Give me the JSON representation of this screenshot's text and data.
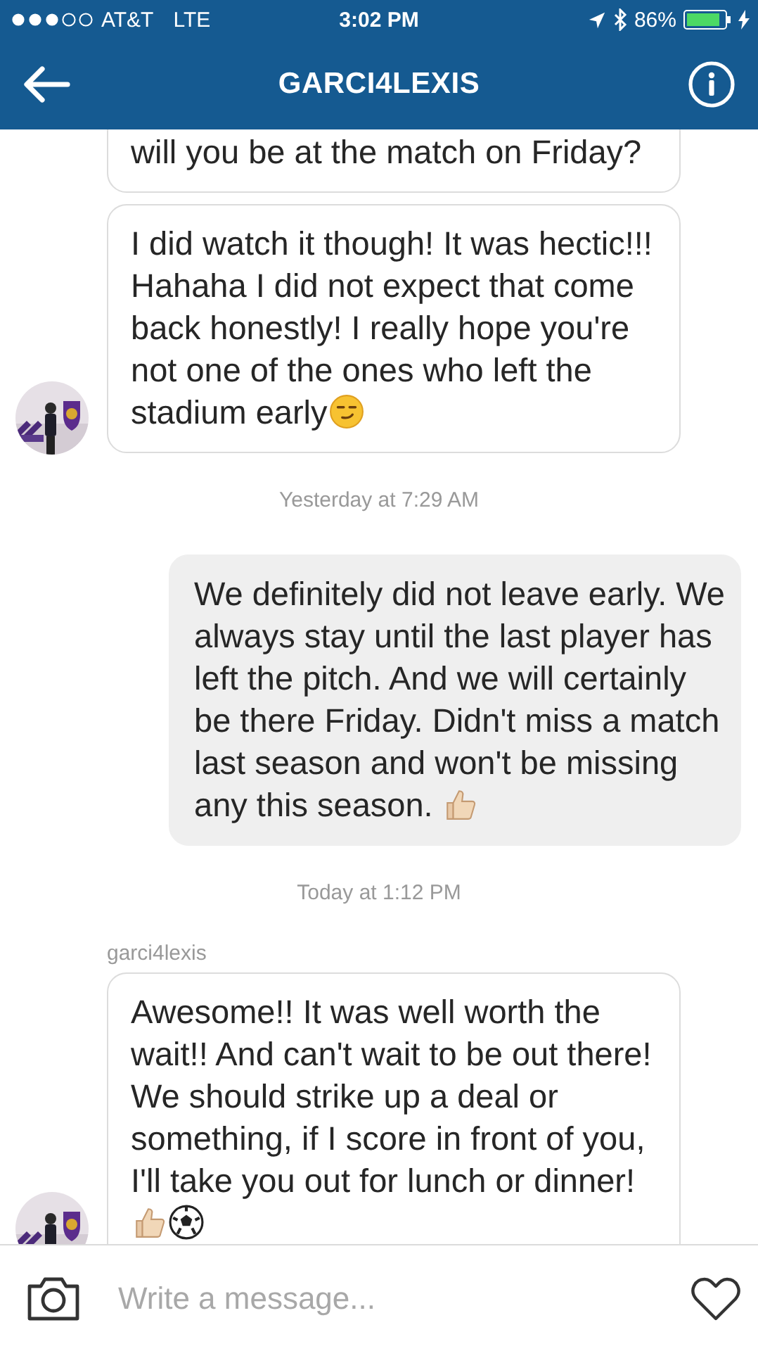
{
  "status_bar": {
    "carrier": "AT&T",
    "network": "LTE",
    "time": "3:02 PM",
    "battery": "86%"
  },
  "header": {
    "title": "GARCI4LEXIS"
  },
  "messages": [
    {
      "kind": "received",
      "text": "will you be at the match on Friday?"
    },
    {
      "kind": "received",
      "text": "I did watch it though! It was hectic!!! Hahaha I did not expect that come back honestly! I really hope you're not one of the ones who left the stadium early",
      "emoji": [
        {
          "kind": "smirk"
        }
      ],
      "avatar": true
    },
    {
      "kind": "timestamp",
      "text": "Yesterday at 7:29 AM"
    },
    {
      "kind": "sent",
      "text": "We definitely did not leave early. We always stay until the last player has left the pitch. And we will certainly be there Friday. Didn't miss a match last season and won't be missing any this season. ",
      "emoji": [
        {
          "kind": "thumbs-up"
        }
      ]
    },
    {
      "kind": "timestamp",
      "text": "Today at 1:12 PM"
    },
    {
      "kind": "sender",
      "text": "garci4lexis"
    },
    {
      "kind": "received",
      "text": "Awesome!! It was well worth the wait!! And can't wait to be out there! We should strike up a deal or something, if I score in front of you, I'll take you out for lunch or dinner!",
      "emoji": [
        {
          "kind": "thumbs-up"
        },
        {
          "kind": "soccer-ball"
        }
      ],
      "avatar": true
    }
  ],
  "composer": {
    "placeholder": "Write a message..."
  }
}
